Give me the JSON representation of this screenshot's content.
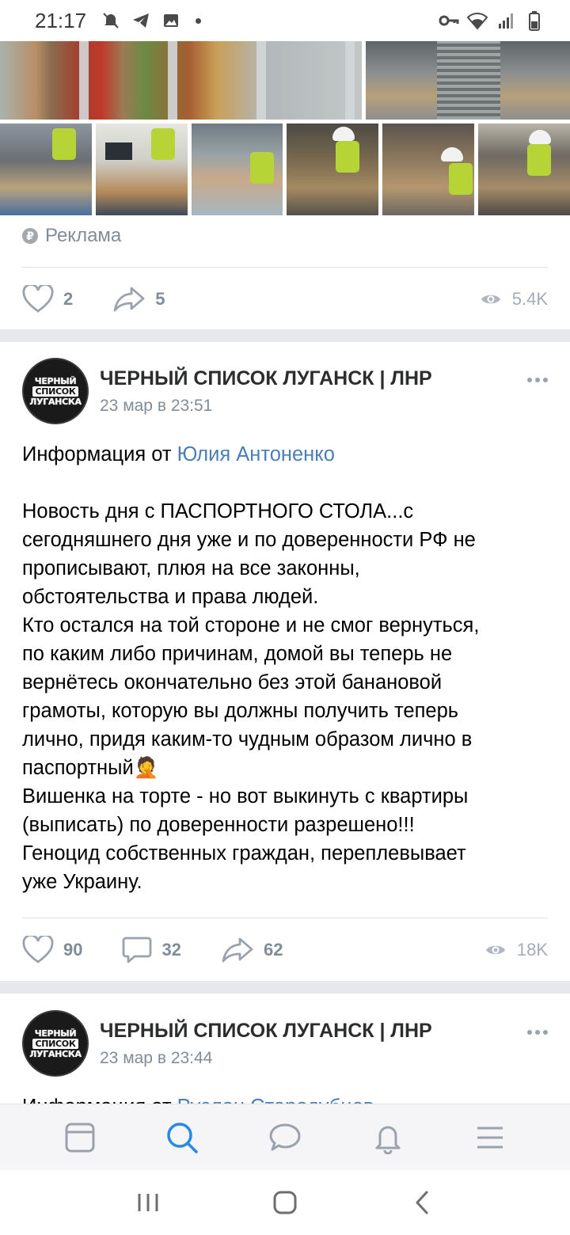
{
  "status_bar": {
    "time": "21:17"
  },
  "ad": {
    "label": "Реклама",
    "likes": "2",
    "shares": "5",
    "views": "5.4K"
  },
  "post1": {
    "author": "ЧЕРНЫЙ СПИСОК ЛУГАНСК | ЛНР",
    "time": "23 мар в 23:51",
    "avatar_lines": [
      "ЧЕРНЫЙ",
      "СПИСОК",
      "ЛУГАНСКА"
    ],
    "intro_prefix": "Информация от ",
    "intro_link": "Юлия Антоненко",
    "lines": [
      "Новость дня с ПАСПОРТНОГО СТОЛА...с",
      "сегодняшнего дня уже и по доверенности РФ не",
      "прописывают, плюя на все законны,",
      "обстоятельства и права людей.",
      "Кто остался на той стороне и не смог вернуться,",
      "по каким либо причинам, домой вы теперь не",
      "вернётесь окончательно без этой банановой",
      "грамоты, которую вы должны получить теперь",
      "лично, придя каким-то чудным образом лично в",
      "паспортный🤦",
      "Вишенка на торте - но вот выкинуть с квартиры",
      "(выписать) по доверенности разрешено!!!",
      "Геноцид собственных граждан, переплевывает",
      "уже Украину."
    ],
    "likes": "90",
    "comments": "32",
    "shares": "62",
    "views": "18K"
  },
  "post2": {
    "author": "ЧЕРНЫЙ СПИСОК ЛУГАНСК | ЛНР",
    "time": "23 мар в 23:44",
    "avatar_lines": [
      "ЧЕРНЫЙ",
      "СПИСОК",
      "ЛУГАНСКА"
    ],
    "intro_prefix": "Информация от ",
    "intro_link": "Руслан Стародубцев"
  },
  "colors": {
    "accent": "#4a7eb7",
    "muted": "#818c99",
    "separator": "#e7e8ec"
  },
  "tabbar": {
    "icons": [
      "feed-icon",
      "search-icon",
      "messages-icon",
      "notifications-icon",
      "menu-icon"
    ],
    "active": "search-icon"
  },
  "system_nav": {
    "icons": [
      "recents-icon",
      "home-icon",
      "back-icon"
    ]
  }
}
